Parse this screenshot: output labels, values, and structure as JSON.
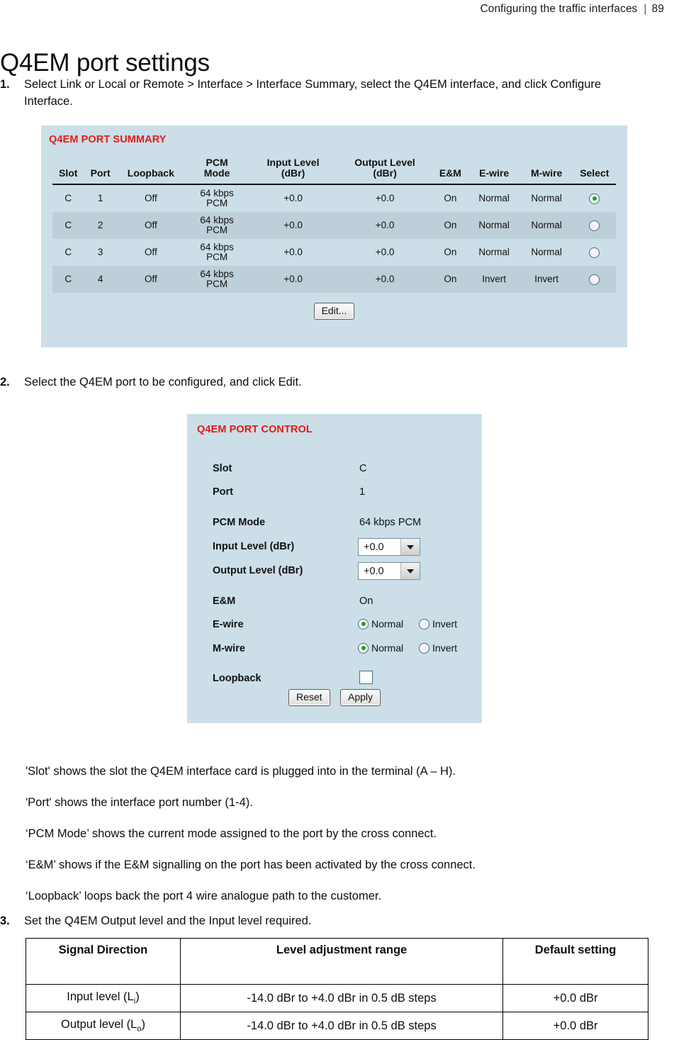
{
  "header": {
    "chapter_title": "Configuring the traffic interfaces",
    "separator": "|",
    "page_number": "89"
  },
  "page_title": "Q4EM port settings",
  "steps": [
    {
      "number": "1.",
      "text": "Select Link or Local or Remote > Interface > Interface Summary, select the Q4EM interface, and click Configure Interface."
    },
    {
      "number": "2.",
      "text": "Select the Q4EM port to be configured, and click Edit."
    },
    {
      "number": "3.",
      "text": "Set the Q4EM Output level and the Input level required."
    }
  ],
  "port_summary": {
    "title": "Q4EM PORT SUMMARY",
    "columns": [
      "Slot",
      "Port",
      "Loopback",
      "PCM Mode",
      "Input Level (dBr)",
      "Output Level (dBr)",
      "E&M",
      "E-wire",
      "M-wire",
      "Select"
    ],
    "column_lines": [
      [
        "Slot"
      ],
      [
        "Port"
      ],
      [
        "Loopback"
      ],
      [
        "PCM",
        "Mode"
      ],
      [
        "Input Level",
        "(dBr)"
      ],
      [
        "Output Level",
        "(dBr)"
      ],
      [
        "E&M"
      ],
      [
        "E-wire"
      ],
      [
        "M-wire"
      ],
      [
        "Select"
      ]
    ],
    "rows": [
      {
        "slot": "C",
        "port": "1",
        "loopback": "Off",
        "pcm_mode_line1": "64 kbps",
        "pcm_mode_line2": "PCM",
        "input_level": "+0.0",
        "output_level": "+0.0",
        "em": "On",
        "e_wire": "Normal",
        "m_wire": "Normal",
        "selected": true
      },
      {
        "slot": "C",
        "port": "2",
        "loopback": "Off",
        "pcm_mode_line1": "64 kbps",
        "pcm_mode_line2": "PCM",
        "input_level": "+0.0",
        "output_level": "+0.0",
        "em": "On",
        "e_wire": "Normal",
        "m_wire": "Normal",
        "selected": false
      },
      {
        "slot": "C",
        "port": "3",
        "loopback": "Off",
        "pcm_mode_line1": "64 kbps",
        "pcm_mode_line2": "PCM",
        "input_level": "+0.0",
        "output_level": "+0.0",
        "em": "On",
        "e_wire": "Normal",
        "m_wire": "Normal",
        "selected": false
      },
      {
        "slot": "C",
        "port": "4",
        "loopback": "Off",
        "pcm_mode_line1": "64 kbps",
        "pcm_mode_line2": "PCM",
        "input_level": "+0.0",
        "output_level": "+0.0",
        "em": "On",
        "e_wire": "Invert",
        "m_wire": "Invert",
        "selected": false
      }
    ],
    "edit_button": "Edit...",
    "panel_bg": "#ccdee7",
    "row_alt_bg": "#bdcfd8",
    "title_color": "#e11b14"
  },
  "port_control": {
    "title": "Q4EM PORT CONTROL",
    "fields": {
      "slot_label": "Slot",
      "slot_value": "C",
      "port_label": "Port",
      "port_value": "1",
      "pcm_mode_label": "PCM Mode",
      "pcm_mode_value": "64 kbps PCM",
      "input_level_label": "Input Level (dBr)",
      "input_level_value": "+0.0",
      "output_level_label": "Output Level (dBr)",
      "output_level_value": "+0.0",
      "em_label": "E&M",
      "em_value": "On",
      "e_wire_label": "E-wire",
      "m_wire_label": "M-wire",
      "radio_normal": "Normal",
      "radio_invert": "Invert",
      "loopback_label": "Loopback"
    },
    "e_wire_selected": "Normal",
    "m_wire_selected": "Normal",
    "loopback_checked": false,
    "reset_button": "Reset",
    "apply_button": "Apply"
  },
  "descriptions": [
    "'Slot' shows the slot the Q4EM interface card is plugged into in the terminal (A – H).",
    "'Port' shows the interface port number (1-4).",
    "‘PCM Mode’ shows the current mode assigned to the port by the cross connect.",
    "‘E&M’ shows if the E&M signalling on the port has been activated by the cross connect.",
    "‘Loopback’ loops back the port 4 wire analogue path to the customer."
  ],
  "spec_table": {
    "headers": [
      "Signal Direction",
      "Level adjustment range",
      "Default setting"
    ],
    "rows": [
      {
        "direction_main": "Input level (L",
        "direction_sub": "i",
        "direction_tail": ")",
        "range": "-14.0 dBr to +4.0 dBr in 0.5 dB steps",
        "default": "+0.0 dBr"
      },
      {
        "direction_main": "Output level (L",
        "direction_sub": "o",
        "direction_tail": ")",
        "range": "-14.0 dBr to +4.0 dBr in 0.5 dB steps",
        "default": "+0.0 dBr"
      }
    ]
  }
}
